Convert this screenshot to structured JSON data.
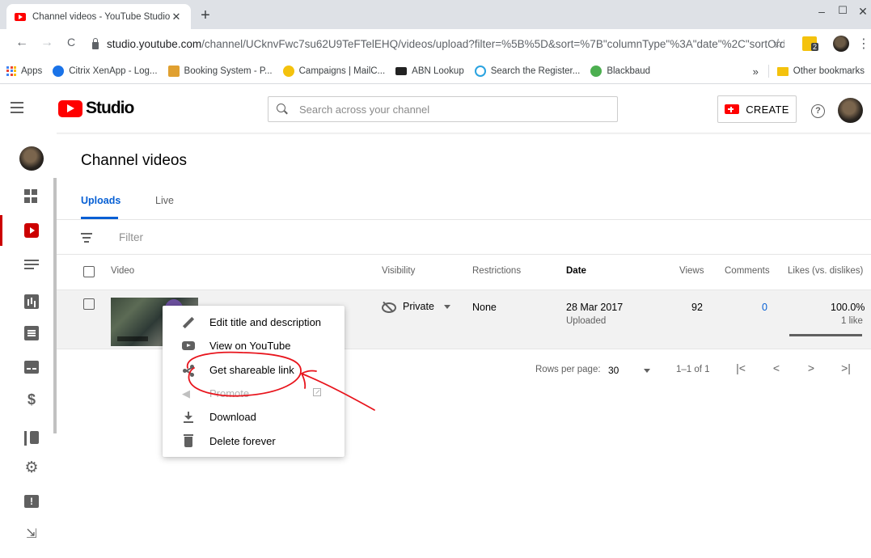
{
  "browser": {
    "tab_title": "Channel videos - YouTube Studio",
    "tab_close": "✕",
    "new_tab": "+",
    "window_controls": {
      "minimize": "–",
      "maximize": "☐",
      "close": "✕"
    },
    "nav": {
      "back": "←",
      "forward": "→",
      "reload": "C"
    },
    "url_host": "studio.youtube.com",
    "url_rest": "/channel/UCknvFwc7su62U9TeFTelEHQ/videos/upload?filter=%5B%5D&sort=%7B\"columnType\"%3A\"date\"%2C\"sortOrder\"...",
    "star": "☆",
    "extension_badge": "2",
    "menu": "⋮",
    "bookmarks": [
      {
        "label": "Apps",
        "icon": "apps-grid-icon",
        "color": "#4285f4"
      },
      {
        "label": "Citrix XenApp - Log...",
        "icon": "citrix-icon",
        "color": "#1a73e8"
      },
      {
        "label": "Booking System - P...",
        "icon": "booking-icon",
        "color": "#e0a030"
      },
      {
        "label": "Campaigns | MailC...",
        "icon": "mailchimp-icon",
        "color": "#f4c20d"
      },
      {
        "label": "ABN Lookup",
        "icon": "abn-icon",
        "color": "#222222"
      },
      {
        "label": "Search the Register...",
        "icon": "register-icon",
        "color": "#2aa3e0"
      },
      {
        "label": "Blackbaud",
        "icon": "blackbaud-icon",
        "color": "#4caf50"
      }
    ],
    "bookmarks_overflow": "»",
    "other_bookmarks": "Other bookmarks"
  },
  "studio": {
    "logo_text": "Studio",
    "search_placeholder": "Search across your channel",
    "create_label": "CREATE",
    "help": "?"
  },
  "rail": {
    "items": [
      "dashboard",
      "videos",
      "playlists",
      "analytics",
      "comments",
      "subtitles",
      "monetization",
      "audio-library",
      "settings",
      "send-feedback",
      "creator-studio-classic"
    ],
    "active": "videos",
    "dollar": "$",
    "gear": "⚙",
    "classic": "⇲"
  },
  "main": {
    "title": "Channel videos",
    "tabs": [
      {
        "label": "Uploads",
        "active": true
      },
      {
        "label": "Live",
        "active": false
      }
    ],
    "filter_placeholder": "Filter",
    "columns": [
      "Video",
      "Visibility",
      "Restrictions",
      "Date",
      "Views",
      "Comments",
      "Likes (vs. dislikes)"
    ],
    "sorted_column": "Date",
    "rows": [
      {
        "visibility": "Private",
        "restrictions": "None",
        "date": "28 Mar 2017",
        "date_status": "Uploaded",
        "views": "92",
        "comments": "0",
        "likes_pct": "100.0%",
        "likes_count": "1 like",
        "likes_fraction": 1.0
      }
    ],
    "pagination": {
      "rows_per_page_label": "Rows per page:",
      "rows_per_page": "30",
      "range": "1–1 of 1",
      "first": "|<",
      "prev": "<",
      "next": ">",
      "last": ">|"
    }
  },
  "context_menu": {
    "items": [
      {
        "label": "Edit title and description",
        "icon": "pencil-icon",
        "enabled": true
      },
      {
        "label": "View on YouTube",
        "icon": "youtube-icon",
        "enabled": true
      },
      {
        "label": "Get shareable link",
        "icon": "share-icon",
        "enabled": true
      },
      {
        "label": "Promote",
        "icon": "megaphone-icon",
        "enabled": false
      },
      {
        "label": "Download",
        "icon": "download-icon",
        "enabled": true
      },
      {
        "label": "Delete forever",
        "icon": "trash-icon",
        "enabled": true
      }
    ]
  },
  "colors": {
    "accent_blue": "#065fd4",
    "brand_red": "#ff0000",
    "annotation_red": "#e8141c"
  }
}
